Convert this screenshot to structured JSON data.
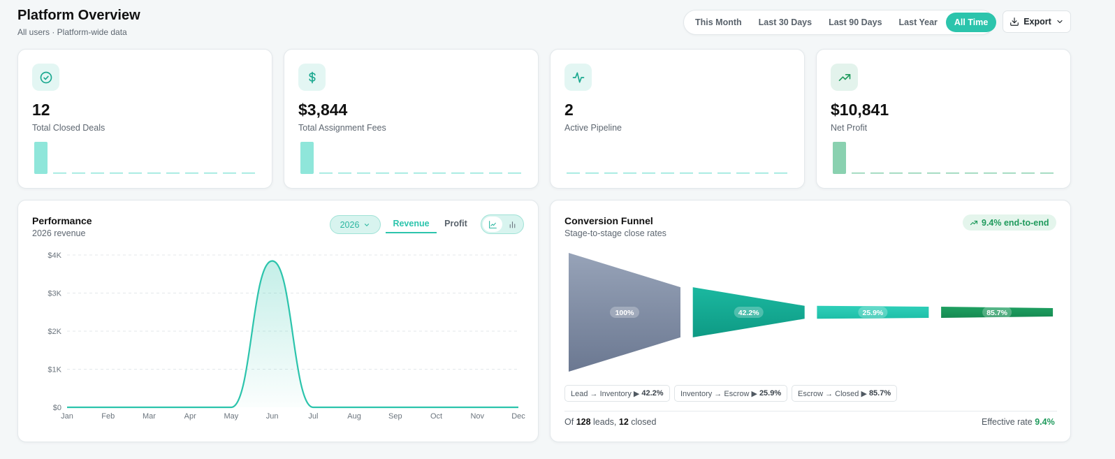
{
  "header": {
    "title": "Platform Overview",
    "subtitle": "All users · Platform-wide data",
    "ranges": [
      "This Month",
      "Last 30 Days",
      "Last 90 Days",
      "Last Year",
      "All Time"
    ],
    "active_range": "All Time",
    "export_label": "Export"
  },
  "stats": [
    {
      "value": "12",
      "label": "Total Closed Deals",
      "icon": "check-circle-icon",
      "spark": [
        1,
        0,
        0,
        0,
        0,
        0,
        0,
        0,
        0,
        0,
        0,
        0
      ],
      "color": "#8fe6da"
    },
    {
      "value": "$3,844",
      "label": "Total Assignment Fees",
      "icon": "dollar-icon",
      "spark": [
        1,
        0,
        0,
        0,
        0,
        0,
        0,
        0,
        0,
        0,
        0,
        0
      ],
      "color": "#8fe6da"
    },
    {
      "value": "2",
      "label": "Active Pipeline",
      "icon": "activity-icon",
      "spark": [
        0,
        0,
        0,
        0,
        0,
        0,
        0,
        0,
        0,
        0,
        0,
        0
      ],
      "color": "#8fe6da"
    },
    {
      "value": "$10,841",
      "label": "Net Profit",
      "icon": "trending-up-icon",
      "spark": [
        1,
        0,
        0,
        0,
        0,
        0,
        0,
        0,
        0,
        0,
        0,
        0
      ],
      "color": "#8ad1b0"
    }
  ],
  "performance": {
    "title": "Performance",
    "subtitle": "2026 revenue",
    "year": "2026",
    "tabs": [
      "Revenue",
      "Profit"
    ],
    "active_tab": "Revenue"
  },
  "chart_data": {
    "type": "area",
    "categories": [
      "Jan",
      "Feb",
      "Mar",
      "Apr",
      "May",
      "Jun",
      "Jul",
      "Aug",
      "Sep",
      "Oct",
      "Nov",
      "Dec"
    ],
    "values": [
      0,
      0,
      0,
      0,
      0,
      3844,
      0,
      0,
      0,
      0,
      0,
      0
    ],
    "yticks": [
      "$0",
      "$1K",
      "$2K",
      "$3K",
      "$4K"
    ],
    "ylim": [
      0,
      4000
    ],
    "grid": true,
    "color": "#2cc4ac"
  },
  "funnel": {
    "title": "Conversion Funnel",
    "subtitle": "Stage-to-stage close rates",
    "end_to_end": "9.4% end-to-end",
    "stages": [
      {
        "pct": "100%",
        "rel": 1.0,
        "color_top": "#97a3b8",
        "color_bottom": "#6b7891"
      },
      {
        "pct": "42.2%",
        "rel": 0.422,
        "color_top": "#1bb8a0",
        "color_bottom": "#0e9a84"
      },
      {
        "pct": "25.9%",
        "rel": 0.109,
        "color_top": "#2fcfb9",
        "color_bottom": "#1ebfa8"
      },
      {
        "pct": "85.7%",
        "rel": 0.094,
        "color_top": "#1fa062",
        "color_bottom": "#168a52"
      }
    ],
    "transitions": [
      {
        "label": "Lead → Inventory ▶",
        "value": "42.2%"
      },
      {
        "label": "Inventory → Escrow ▶",
        "value": "25.9%"
      },
      {
        "label": "Escrow → Closed ▶",
        "value": "85.7%"
      }
    ],
    "footer": {
      "of": "Of",
      "leads": "128",
      "leads_label": "leads,",
      "closed": "12",
      "closed_label": "closed",
      "rate_label": "Effective rate",
      "rate": "9.4%"
    }
  }
}
